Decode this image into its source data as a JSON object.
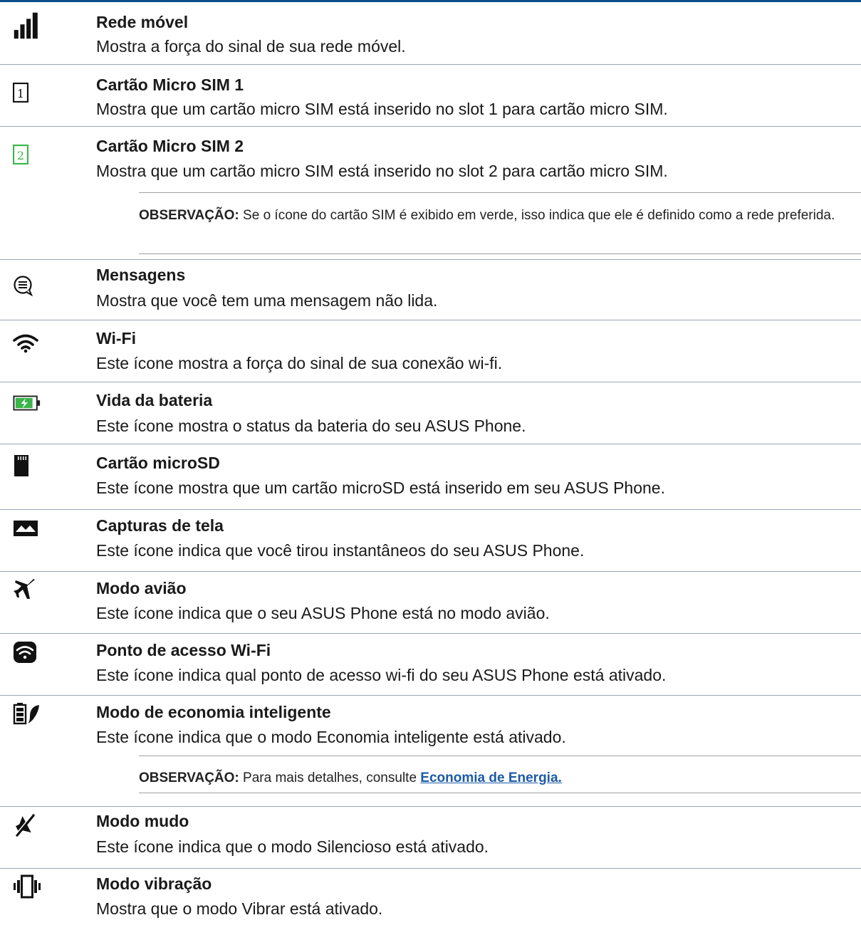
{
  "items": [
    {
      "icon": "signal-bars-icon",
      "title": "Rede móvel",
      "desc": "Mostra a força do sinal de sua rede móvel."
    },
    {
      "icon": "sim-card-1-icon",
      "title": "Cartão Micro SIM 1",
      "desc": "Mostra que um cartão micro SIM está inserido no slot 1 para cartão micro SIM."
    },
    {
      "icon": "sim-card-2-icon",
      "title": "Cartão Micro SIM 2",
      "desc": "Mostra que um cartão micro SIM está inserido no slot 2 para cartão micro SIM."
    },
    {
      "icon": "message-icon",
      "title": "Mensagens",
      "desc": "Mostra que você tem uma mensagem não lida."
    },
    {
      "icon": "wifi-icon",
      "title": "Wi-Fi",
      "desc": "Este ícone mostra a força do sinal de sua conexão wi-fi."
    },
    {
      "icon": "battery-charging-icon",
      "title": "Vida da bateria",
      "desc": "Este ícone mostra o status da bateria do seu ASUS Phone."
    },
    {
      "icon": "microsd-icon",
      "title": "Cartão microSD",
      "desc": "Este ícone mostra que um cartão microSD está inserido em seu ASUS Phone."
    },
    {
      "icon": "screenshot-icon",
      "title": "Capturas de tela",
      "desc": "Este ícone indica que você tirou instantâneos do seu ASUS Phone."
    },
    {
      "icon": "airplane-icon",
      "title": "Modo avião",
      "desc": "Este ícone indica que o seu ASUS Phone está no modo avião."
    },
    {
      "icon": "hotspot-icon",
      "title": "Ponto de acesso Wi-Fi",
      "desc": "Este ícone indica qual ponto de acesso wi-fi do seu ASUS Phone está ativado."
    },
    {
      "icon": "smart-saving-icon",
      "title": "Modo de economia inteligente",
      "desc": "Este ícone indica que o modo Economia inteligente está ativado."
    },
    {
      "icon": "mute-icon",
      "title": "Modo mudo",
      "desc": "Este ícone indica que o modo Silencioso está ativado."
    },
    {
      "icon": "vibrate-icon",
      "title": "Modo vibração",
      "desc": "Mostra que o modo Vibrar está ativado."
    }
  ],
  "notes": {
    "sim": {
      "label": "OBSERVAÇÃO:",
      "text": " Se o ícone do cartão SIM é exibido em verde, isso indica que ele é definido como a rede preferida."
    },
    "energy": {
      "label": "OBSERVAÇÃO:",
      "text": " Para mais detalhes, consulte ",
      "link": "Economia de Energia."
    }
  },
  "colors": {
    "accent_line": "#0b4f8a",
    "sim2_green": "#3bb54a",
    "link": "#1b5aa6"
  }
}
